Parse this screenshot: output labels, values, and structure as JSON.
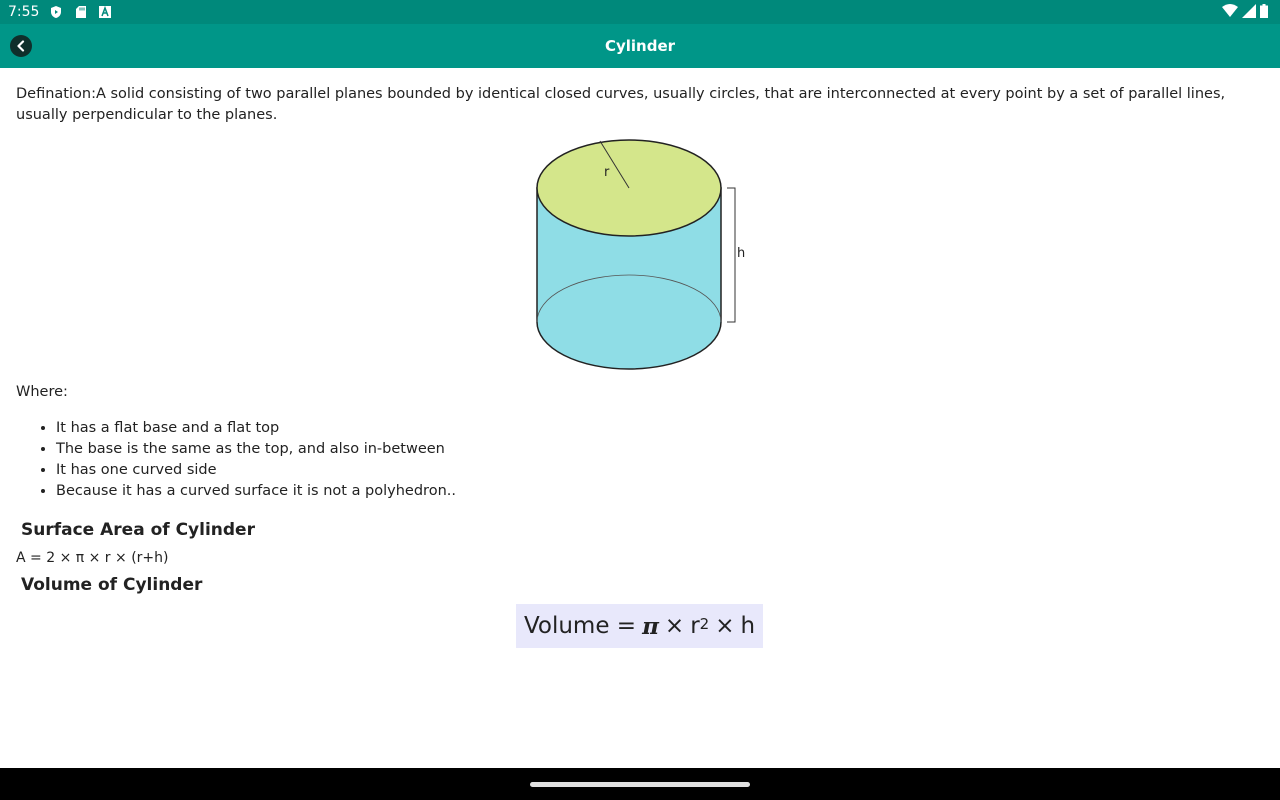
{
  "status_bar": {
    "time": "7:55",
    "icons_left": [
      "shield-play-icon",
      "sd-card-icon",
      "font-a-icon"
    ],
    "icons_right": [
      "wifi-icon",
      "signal-icon",
      "battery-icon"
    ]
  },
  "app_bar": {
    "title": "Cylinder",
    "back_icon": "chevron-left-icon"
  },
  "content": {
    "definition": "Defination:A solid consisting of two parallel planes bounded by identical closed curves, usually circles, that are interconnected at every point by a set of parallel lines, usually perpendicular to the planes.",
    "diagram": {
      "radius_label": "r",
      "height_label": "h",
      "top_color": "#d4e68b",
      "body_color": "#8fdde6"
    },
    "where_label": "Where:",
    "bullets": [
      "It has a flat base and a flat top",
      "The base is the same as the top, and also in-between",
      "It has one curved side",
      "Because it has a curved surface it is not a polyhedron.."
    ],
    "surface_area_title": "Surface Area of Cylinder",
    "surface_area_formula": "A = 2 × π × r × (r+h)",
    "volume_title": "Volume of Cylinder",
    "volume_formula": {
      "lhs": "Volume =",
      "pi": "π",
      "times1": "×",
      "r": "r",
      "exp": "2",
      "times2": "×",
      "h": "h"
    }
  },
  "colors": {
    "status_bar": "#00897b",
    "app_bar": "#009688",
    "formula_bg": "#e8e8fb"
  }
}
